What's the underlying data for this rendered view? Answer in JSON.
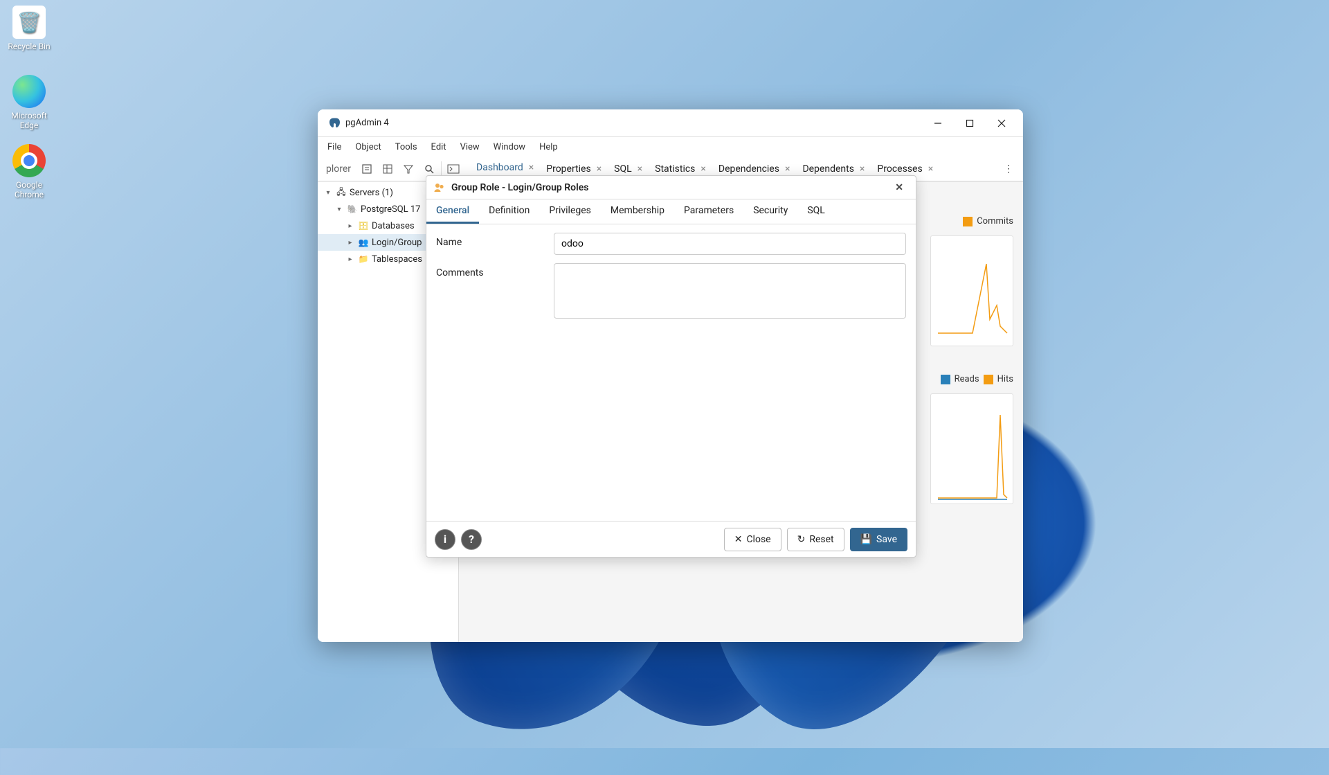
{
  "desktop": {
    "icons": [
      {
        "label": "Recycle Bin"
      },
      {
        "label": "Microsoft Edge"
      },
      {
        "label": "Google Chrome"
      }
    ]
  },
  "window": {
    "title": "pgAdmin 4",
    "menu": [
      "File",
      "Object",
      "Tools",
      "Edit",
      "View",
      "Window",
      "Help"
    ],
    "explorer_label": "plorer",
    "tabs": [
      {
        "label": "Dashboard",
        "active": true
      },
      {
        "label": "Properties",
        "active": false
      },
      {
        "label": "SQL",
        "active": false
      },
      {
        "label": "Statistics",
        "active": false
      },
      {
        "label": "Dependencies",
        "active": false
      },
      {
        "label": "Dependents",
        "active": false
      },
      {
        "label": "Processes",
        "active": false
      }
    ],
    "tree": {
      "servers_label": "Servers (1)",
      "server_name": "PostgreSQL 17",
      "children": [
        {
          "label": "Databases"
        },
        {
          "label": "Login/Group"
        },
        {
          "label": "Tablespaces"
        }
      ]
    },
    "legends": {
      "commits": "Commits",
      "reads": "Reads",
      "hits": "Hits"
    }
  },
  "dialog": {
    "title": "Group Role - Login/Group Roles",
    "tabs": [
      "General",
      "Definition",
      "Privileges",
      "Membership",
      "Parameters",
      "Security",
      "SQL"
    ],
    "active_tab": "General",
    "fields": {
      "name_label": "Name",
      "name_value": "odoo",
      "comments_label": "Comments",
      "comments_value": ""
    },
    "buttons": {
      "close": "Close",
      "reset": "Reset",
      "save": "Save"
    }
  },
  "colors": {
    "accent": "#326690",
    "commits": "#f39c12",
    "reads": "#2980b9",
    "hits": "#f39c12"
  }
}
